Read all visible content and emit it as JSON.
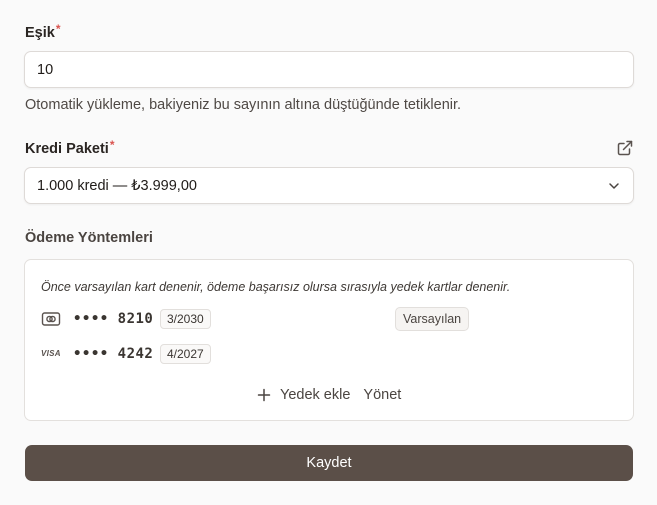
{
  "threshold": {
    "label": "Eşik",
    "required_mark": "*",
    "value": "10",
    "help": "Otomatik yükleme, bakiyeniz bu sayının altına düştüğünde tetiklenir."
  },
  "credit_package": {
    "label": "Kredi Paketi",
    "required_mark": "*",
    "selected": "1.000 kredi — ₺3.999,00"
  },
  "payment_methods": {
    "label": "Ödeme Yöntemleri",
    "hint": "Önce varsayılan kart denenir, ödeme başarısız olursa sırasıyla yedek kartlar denenir.",
    "cards": [
      {
        "brand_icon": "card-icon",
        "masked": "•••• 8210",
        "expiry": "3/2030",
        "badge": "Varsayılan"
      },
      {
        "brand_icon": "visa-icon",
        "brand_text": "VISA",
        "masked": "•••• 4242",
        "expiry": "4/2027"
      }
    ],
    "add_label": "Yedek ekle",
    "manage_label": "Yönet"
  },
  "save_label": "Kaydet",
  "colors": {
    "primary_button": "#5b4f48",
    "required": "#d9534f"
  }
}
